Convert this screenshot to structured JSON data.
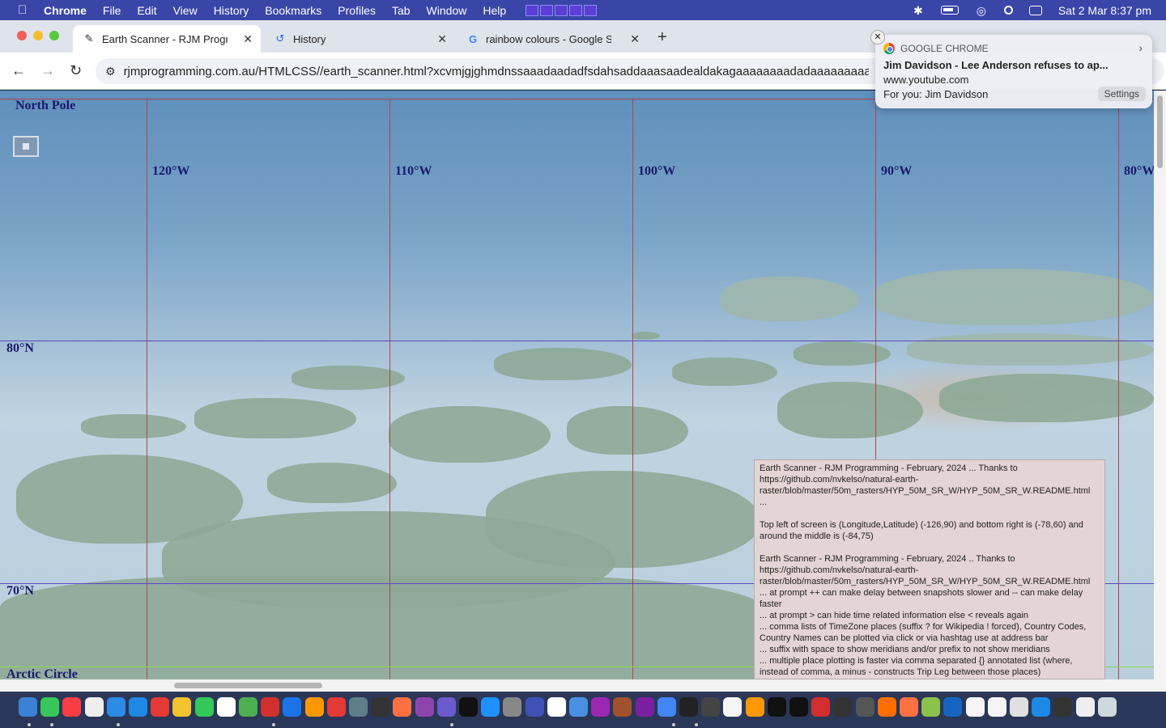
{
  "menubar": {
    "app": "Chrome",
    "items": [
      "File",
      "Edit",
      "View",
      "History",
      "Bookmarks",
      "Profiles",
      "Tab",
      "Window",
      "Help"
    ],
    "clock": "Sat 2 Mar  8:37 pm"
  },
  "tabs": [
    {
      "label": "Earth Scanner - RJM Programming",
      "icon": "earth-scanner-favicon"
    },
    {
      "label": "History",
      "icon": "history-icon"
    },
    {
      "label": "rainbow colours - Google Search",
      "icon": "google-icon"
    }
  ],
  "toolbar": {
    "url": "rjmprogramming.com.au/HTMLCSS//earth_scanner.html?xcvmjgjghmdnssaaadaadadfsdahsaddaaasaadealdakagaaaaaaaadadaaaaaaaaakadd"
  },
  "map": {
    "labels": {
      "north_pole": "North Pole",
      "lon_120": "120°W",
      "lon_110": "110°W",
      "lon_100": "100°W",
      "lon_90": "90°W",
      "lon_80": "80°W",
      "lat_80": "80°N",
      "lat_70": "70°N",
      "arctic_circle": "Arctic Circle"
    }
  },
  "infobox": {
    "para1": "Earth Scanner - RJM Programming - February, 2024 ... Thanks to https://github.com/nvkelso/natural-earth-raster/blob/master/50m_rasters/HYP_50M_SR_W/HYP_50M_SR_W.README.html ...",
    "para2": "Top left of screen is (Longitude,Latitude) (-126,90) and bottom right is (-78,60) and around the middle is (-84,75)",
    "para3": "Earth Scanner - RJM Programming - February, 2024 .. Thanks to https://github.com/nvkelso/natural-earth-raster/blob/master/50m_rasters/HYP_50M_SR_W/HYP_50M_SR_W.README.html",
    "line1": " ... at prompt ++ can make delay between snapshots slower and -- can make delay faster",
    "line2": " ... at prompt > can hide time related information else < reveals again",
    "line3": " ... comma lists of TimeZone places (suffix ? for Wikipedia ! forced), Country Codes, Country Names can be plotted via click or via hashtag use at address bar",
    "line4": " ... suffix with space to show meridians and/or prefix to not show meridians",
    "line5": " ... multiple place plotting is faster via comma separated {} annotated list (where, instead of comma, a minus - constructs Trip Leg between those places)"
  },
  "notification": {
    "app": "GOOGLE CHROME",
    "title": "Jim Davidson - Lee Anderson refuses to ap...",
    "site": "www.youtube.com",
    "body": "For you: Jim Davidson",
    "settings": "Settings"
  },
  "colors": {
    "menubar": "#3a45a8",
    "meridian": "#b04848",
    "parallel": "#5a48c8",
    "arctic_circle": "#8ad84a",
    "infobox_bg": "#e4d4d6"
  }
}
